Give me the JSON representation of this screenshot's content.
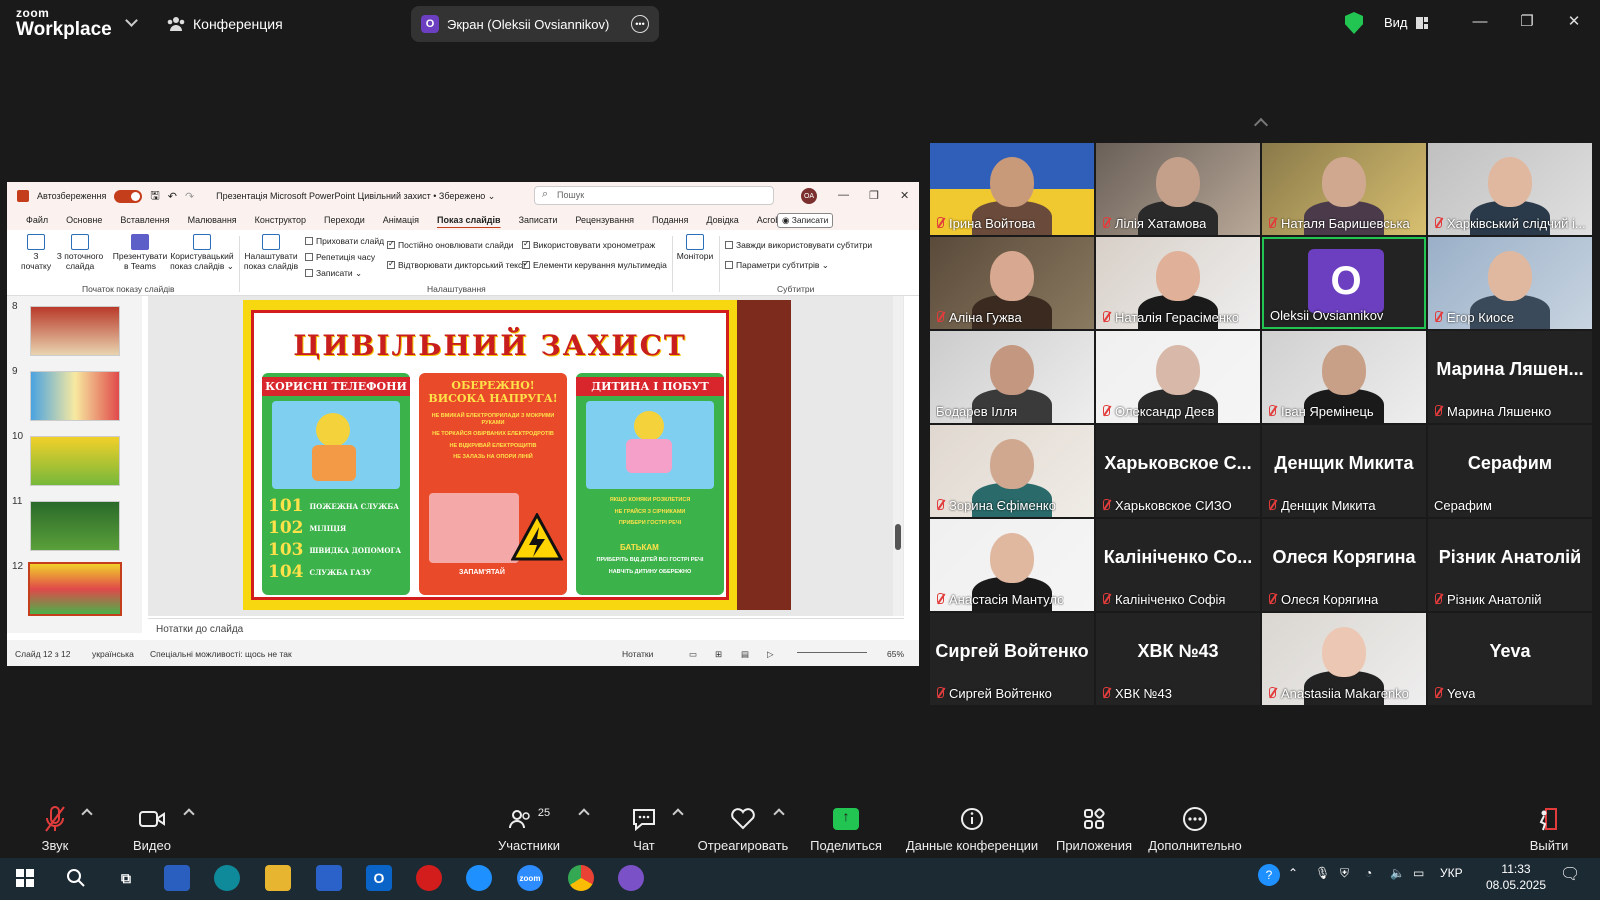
{
  "app": {
    "brand_line1": "zoom",
    "brand_line2": "Workplace",
    "meeting_label": "Конференция",
    "screen_owner_badge": "O",
    "screen_label": "Экран (Oleksii Ovsiannikov)",
    "view_label": "Вид",
    "security_color": "#23c552"
  },
  "ppt": {
    "autosave": "Автозбереження",
    "title": "Презентація Microsoft PowerPoint Цивільний захист • Збережено ⌄",
    "search_placeholder": "Пошук",
    "avatar": "OA",
    "tabs": [
      "Файл",
      "Основне",
      "Вставлення",
      "Малювання",
      "Конструктор",
      "Переходи",
      "Анімація",
      "Показ слайдів",
      "Записати",
      "Рецензування",
      "Подання",
      "Довідка",
      "Acrobat"
    ],
    "active_tab": "Показ слайдів",
    "record_btn": "◉ Записати",
    "ribbon": {
      "from_start": "З\nпочатку",
      "from_current": "З поточного\nслайда",
      "teams": "Презентувати\nв Teams",
      "custom": "Користувацький\nпоказ слайдів ⌄",
      "group1": "Початок показу слайдів",
      "setup": "Налаштувати\nпоказ слайдів",
      "hide": "Приховати слайд",
      "rehearse": "Репетиція часу",
      "record": "Записати ⌄",
      "opt1": "Постійно оновлювати слайди",
      "opt2": "Використовувати хронометраж",
      "opt3": "Відтворювати дикторський текст",
      "opt4": "Елементи керування мультимедіа",
      "group2": "Налаштування",
      "monitors": "Монітори",
      "sub1": "Завжди використовувати субтитри",
      "sub2": "Параметри субтитрів ⌄",
      "group3": "Субтитри"
    },
    "thumbnails": [
      "8",
      "9",
      "10",
      "11",
      "12"
    ],
    "poster": {
      "title": "ЦИВІЛЬНИЙ ЗАХИСТ",
      "col1_head": "КОРИСНІ ТЕЛЕФОНИ",
      "col2_head": "ОБЕРЕЖНО!\nВИСОКА НАПРУГА!",
      "col3_head": "ДИТИНА І ПОБУТ",
      "phones": [
        {
          "num": "101",
          "label": "ПОЖЕЖНА СЛУЖБА"
        },
        {
          "num": "102",
          "label": "МІЛІЦІЯ"
        },
        {
          "num": "103",
          "label": "ШВИДКА ДОПОМОГА"
        },
        {
          "num": "104",
          "label": "СЛУЖБА ГАЗУ"
        }
      ],
      "col2_lines": [
        "НЕ ВМИКАЙ ЕЛЕКТРОПРИЛАДИ З МОКРИМИ РУКАМИ",
        "НЕ ТОРКАЙСЯ ОБІРВАНИХ ЕЛЕКТРОДРОТІВ",
        "НЕ ВІДКРИВАЙ ЕЛЕКТРОЩИТІВ",
        "НЕ ЗАЛАЗЬ НА ОПОРИ ЛІНІЙ"
      ],
      "col2_bottom": "ЗАПАМ'ЯТАЙ",
      "col3_lines": [
        "ЯКЩО КОНЯКИ РОЗКЛЕТИСЯ",
        "НЕ ГРАЙСЯ З СІРНИКАМИ",
        "ПРИБЕРИ ГОСТРІ РЕЧІ"
      ],
      "col3_mid": "БАТЬКАМ",
      "col3_bottom": [
        "ПРИБЕРІТЬ ВІД ДІТЕЙ ВСІ ГОСТРІ РЕЧІ",
        "НАВЧІТЬ ДИТИНУ ОБЕРЕЖНО"
      ]
    },
    "notes_placeholder": "Нотатки до слайда",
    "status": {
      "slide": "Слайд 12 з 12",
      "lang": "українська",
      "access": "Спеціальні можливості: щось не так",
      "notes": "Нотатки",
      "zoom": "65%"
    }
  },
  "participants": [
    {
      "name": "Ірина Войтова",
      "video": true,
      "muted": true
    },
    {
      "name": "Лілія Хатамова",
      "video": true,
      "muted": true
    },
    {
      "name": "Наталя Баришевська",
      "video": true,
      "muted": true
    },
    {
      "name": "Харківський слідчий і...",
      "video": true,
      "muted": true
    },
    {
      "name": "Аліна Гужва",
      "video": true,
      "muted": true
    },
    {
      "name": "Наталія Герасіменко",
      "video": true,
      "muted": true
    },
    {
      "name": "Oleksii Ovsiannikov",
      "video": false,
      "muted": false,
      "avatar": "O",
      "active": true
    },
    {
      "name": "Егор Киосе",
      "video": true,
      "muted": true
    },
    {
      "name": "Бодарев Ілля",
      "video": true,
      "muted": false
    },
    {
      "name": "Олександр Деєв",
      "video": true,
      "muted": true
    },
    {
      "name": "Іван Яремінець",
      "video": true,
      "muted": true
    },
    {
      "name": "Марина Ляшенко",
      "video": false,
      "muted": true,
      "big": "Марина Ляшен..."
    },
    {
      "name": "Зорина Єфіменко",
      "video": true,
      "muted": true
    },
    {
      "name": "Харьковское СИЗО",
      "video": false,
      "muted": true,
      "big": "Харьковское С..."
    },
    {
      "name": "Денщик Микита",
      "video": false,
      "muted": true,
      "big": "Денщик Микита"
    },
    {
      "name": "Серафим",
      "video": false,
      "muted": false,
      "big": "Серафим"
    },
    {
      "name": "Анастасія Мантуло",
      "video": true,
      "muted": true
    },
    {
      "name": "Калініченко Софія",
      "video": false,
      "muted": true,
      "big": "Калініченко Со..."
    },
    {
      "name": "Олеся Корягина",
      "video": false,
      "muted": true,
      "big": "Олеся Корягина"
    },
    {
      "name": "Різник Анатолій",
      "video": false,
      "muted": true,
      "big": "Різник Анатолій"
    },
    {
      "name": "Сиргей Войтенко",
      "video": false,
      "muted": true,
      "big": "Сиргей Войтенко"
    },
    {
      "name": "ХВК №43",
      "video": false,
      "muted": true,
      "big": "ХВК №43"
    },
    {
      "name": "Anastasiia Makarenko",
      "video": true,
      "muted": true
    },
    {
      "name": "Yeva",
      "video": false,
      "muted": true,
      "big": "Yeva"
    }
  ],
  "controls": {
    "audio": "Звук",
    "video": "Видео",
    "participants": "Участники",
    "participants_count": "25",
    "chat": "Чат",
    "react": "Отреагировать",
    "share": "Поделиться",
    "info": "Данные конференции",
    "apps": "Приложения",
    "more": "Дополнительно",
    "leave": "Выйти"
  },
  "taskbar": {
    "lang": "УКР",
    "time": "11:33",
    "date": "08.05.2025"
  }
}
